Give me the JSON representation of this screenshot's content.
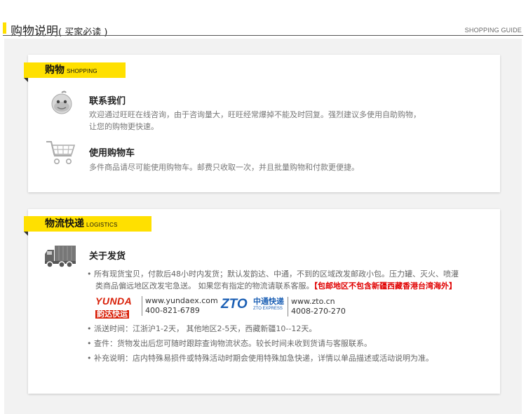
{
  "header": {
    "title": "购物说明",
    "subtitle": "( 买家必读 )",
    "guide": "SHOPPING GUIDE"
  },
  "shopping": {
    "tag_cn": "购物",
    "tag_en": "SHOPPING",
    "items": [
      {
        "icon": "wangwang-icon",
        "title": "联系我们",
        "lines": [
          "欢迎通过旺旺在线咨询，由于咨询量大，旺旺经常爆掉不能及时回复。强烈建议多使用自助购物，",
          "让您的购物更快速。"
        ]
      },
      {
        "icon": "shopping-cart-icon",
        "title": "使用购物车",
        "lines": [
          "多件商品请尽可能使用购物车。邮费只收取一次，并且批量购物和付款更便捷。"
        ]
      }
    ]
  },
  "logistics": {
    "tag_cn": "物流快递",
    "tag_en": "LOGISTICS",
    "item": {
      "icon": "delivery-truck-icon",
      "title": "关于发货",
      "bullet1_line1": "• 所有现货宝贝，付款后48小时内发货；默认发韵达、中通，不到的区域改发邮政小包。压力罐、灭火、喷灌",
      "bullet1_line2_normal": "类商品偏远地区改发宅急送。 如果您有指定的物流请联系客服。",
      "bullet1_line2_red": "【包邮地区不包含新疆西藏香港台湾海外】",
      "couriers": [
        {
          "logo_top": "YUNDA",
          "logo_bottom": "韵达快运",
          "url": "www.yundaex.com",
          "phone": "400-821-6789",
          "color": "#d81e06"
        },
        {
          "logo_top": "ZTO",
          "logo_cn": "中通快递",
          "logo_en": "ZTO EXPRESS",
          "url": "www.zto.cn",
          "phone": "4008-270-270",
          "color": "#1b5fb4"
        }
      ],
      "bullets": [
        "• 派送时间：江浙沪1-2天，  其他地区2-5天，西藏新疆10--12天。",
        "• 查件：货物发出后您可随时跟踪查询物流状态。较长时间未收到货请与客服联系。",
        "• 补充说明：店内特殊易损件或特殊活动时期会使用特殊加急快递，详情以单品描述或活动说明为准。"
      ]
    }
  }
}
